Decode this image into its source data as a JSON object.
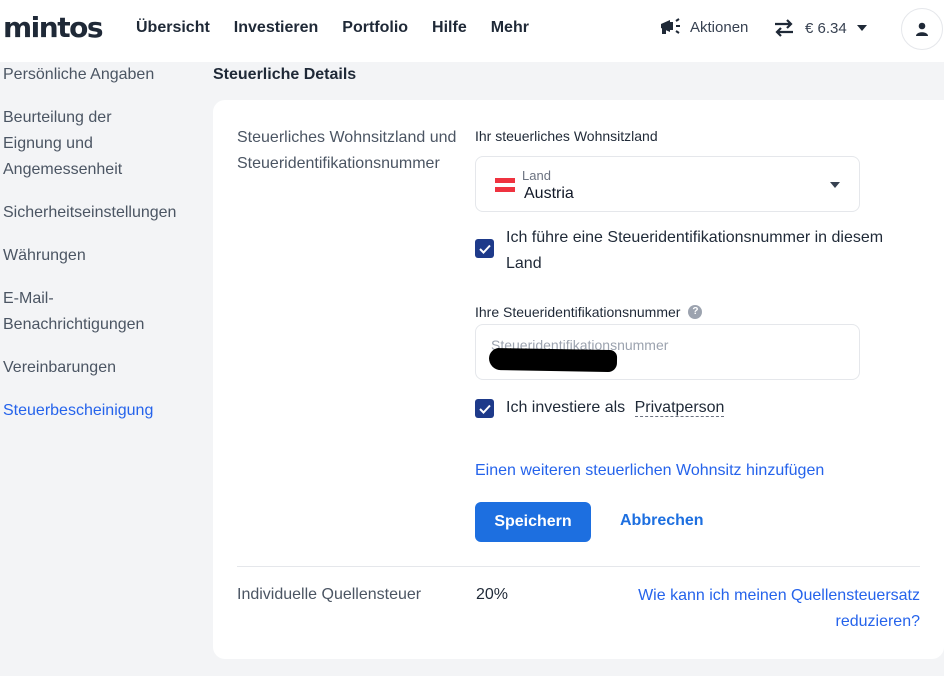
{
  "header": {
    "logo": "mintos",
    "nav": [
      "Übersicht",
      "Investieren",
      "Portfolio",
      "Hilfe",
      "Mehr"
    ],
    "actions_label": "Aktionen",
    "balance": "€ 6.34"
  },
  "sidebar": {
    "items": [
      {
        "label": "Persönliche Angaben",
        "active": false
      },
      {
        "label": "Beurteilung der Eignung und Angemessenheit",
        "active": false
      },
      {
        "label": "Sicherheitseinstellungen",
        "active": false
      },
      {
        "label": "Währungen",
        "active": false
      },
      {
        "label": "E-Mail-Benachrichtigungen",
        "active": false
      },
      {
        "label": "Vereinbarungen",
        "active": false
      },
      {
        "label": "Steuerbescheinigung",
        "active": true
      }
    ]
  },
  "main": {
    "section_title": "Steuerliche Details",
    "row_label": "Steuerliches Wohnsitzland und Steueridentifikationsnummer",
    "residence_title": "Ihr steuerliches Wohnsitzland",
    "country_select": {
      "label": "Land",
      "value": "Austria"
    },
    "tin_checkbox": {
      "label": "Ich führe eine Steueridentifikationsnummer in diesem Land",
      "checked": true
    },
    "tin_field": {
      "title": "Ihre Steueridentifikationsnummer",
      "placeholder": "Steueridentifikationsnummer",
      "value_redacted": true
    },
    "private_checkbox": {
      "label_prefix": "Ich investiere als",
      "label_link": "Privatperson",
      "checked": true
    },
    "add_residence_link": "Einen weiteren steuerlichen Wohnsitz hinzufügen",
    "save_button": "Speichern",
    "cancel_button": "Abbrechen",
    "withholding": {
      "label": "Individuelle Quellensteuer",
      "value": "20%",
      "link": "Wie kann ich meinen Quellensteuersatz reduzieren?"
    }
  },
  "colors": {
    "accent": "#1d6fe0",
    "link": "#2563eb",
    "checkbox": "#1e3a8a",
    "background": "#f3f4f6"
  },
  "icons": {
    "actions": "megaphone-icon",
    "balance": "swap-arrows-icon",
    "avatar": "user-icon",
    "help": "question-circle-icon",
    "check": "checkmark-icon",
    "flag": "austria-flag-icon"
  }
}
